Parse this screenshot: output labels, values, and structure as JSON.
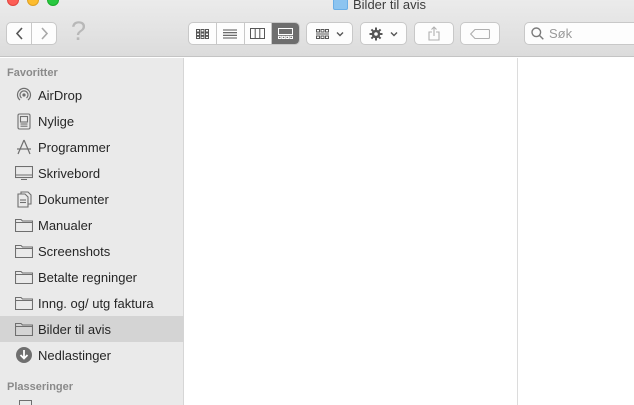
{
  "window": {
    "title": "Bilder til avis"
  },
  "toolbar": {
    "back_icon": "chevron-left-icon",
    "forward_icon": "chevron-right-icon",
    "help_glyph": "?",
    "view_modes": [
      "icon-view",
      "list-view",
      "column-view",
      "gallery-view"
    ],
    "active_view": "gallery-view",
    "group_menu_icon": "group-icon",
    "action_menu_icon": "gear-icon",
    "share_icon": "share-icon",
    "tag_icon": "tag-icon",
    "search_placeholder": "Søk"
  },
  "sidebar": {
    "favorites_title": "Favoritter",
    "locations_title": "Plasseringer",
    "items": [
      {
        "label": "AirDrop",
        "icon": "airdrop-icon"
      },
      {
        "label": "Nylige",
        "icon": "recents-icon"
      },
      {
        "label": "Programmer",
        "icon": "applications-icon"
      },
      {
        "label": "Skrivebord",
        "icon": "desktop-icon"
      },
      {
        "label": "Dokumenter",
        "icon": "documents-icon"
      },
      {
        "label": "Manualer",
        "icon": "folder-icon"
      },
      {
        "label": "Screenshots",
        "icon": "folder-icon"
      },
      {
        "label": "Betalte regninger",
        "icon": "folder-icon"
      },
      {
        "label": "Inng. og/ utg faktura",
        "icon": "folder-icon"
      },
      {
        "label": "Bilder til avis",
        "icon": "folder-icon",
        "selected": true
      },
      {
        "label": "Nedlastinger",
        "icon": "downloads-icon"
      }
    ]
  },
  "colors": {
    "sidebar_bg": "#eaeaea",
    "selected_bg": "#d4d4d4",
    "toolbar_bg": "#e4e4e4",
    "active_segment": "#6e6e6e"
  }
}
